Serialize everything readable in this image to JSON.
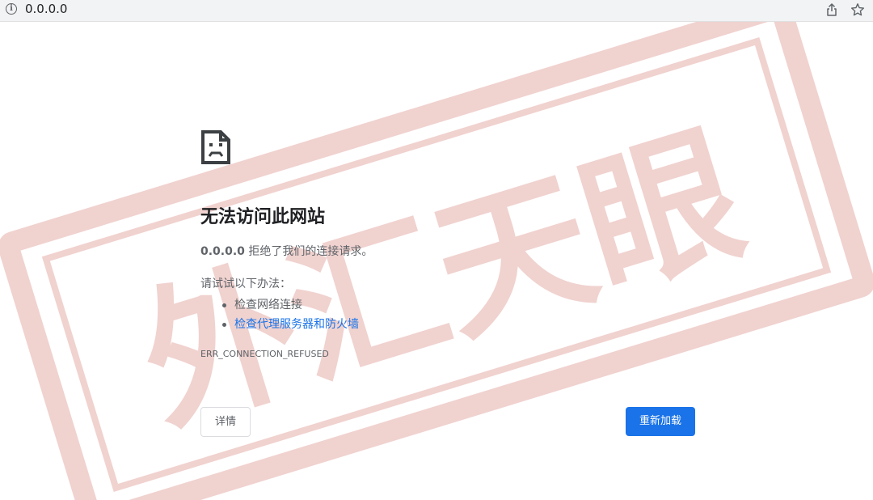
{
  "address_bar": {
    "url": "0.0.0.0",
    "info_icon_glyph": "i",
    "icons": [
      "info-icon",
      "share-icon",
      "star-icon"
    ]
  },
  "error_page": {
    "icon": "sad-file-icon",
    "title": "无法访问此网站",
    "summary_host": "0.0.0.0",
    "summary_text": " 拒绝了我们的连接请求。",
    "suggestions_header": "请试试以下办法：",
    "suggestions": [
      {
        "text": "检查网络连接",
        "is_link": false
      },
      {
        "text": "检查代理服务器和防火墙",
        "is_link": true
      }
    ],
    "error_code": "ERR_CONNECTION_REFUSED",
    "details_button": "详情",
    "reload_button": "重新加载"
  },
  "colors": {
    "accent": "#1a73e8",
    "text_primary": "#202124",
    "text_secondary": "#5f6368",
    "toolbar_bg": "#f1f3f4",
    "stamp": "#c0392b"
  },
  "watermark": {
    "text": "外汇天眼"
  }
}
